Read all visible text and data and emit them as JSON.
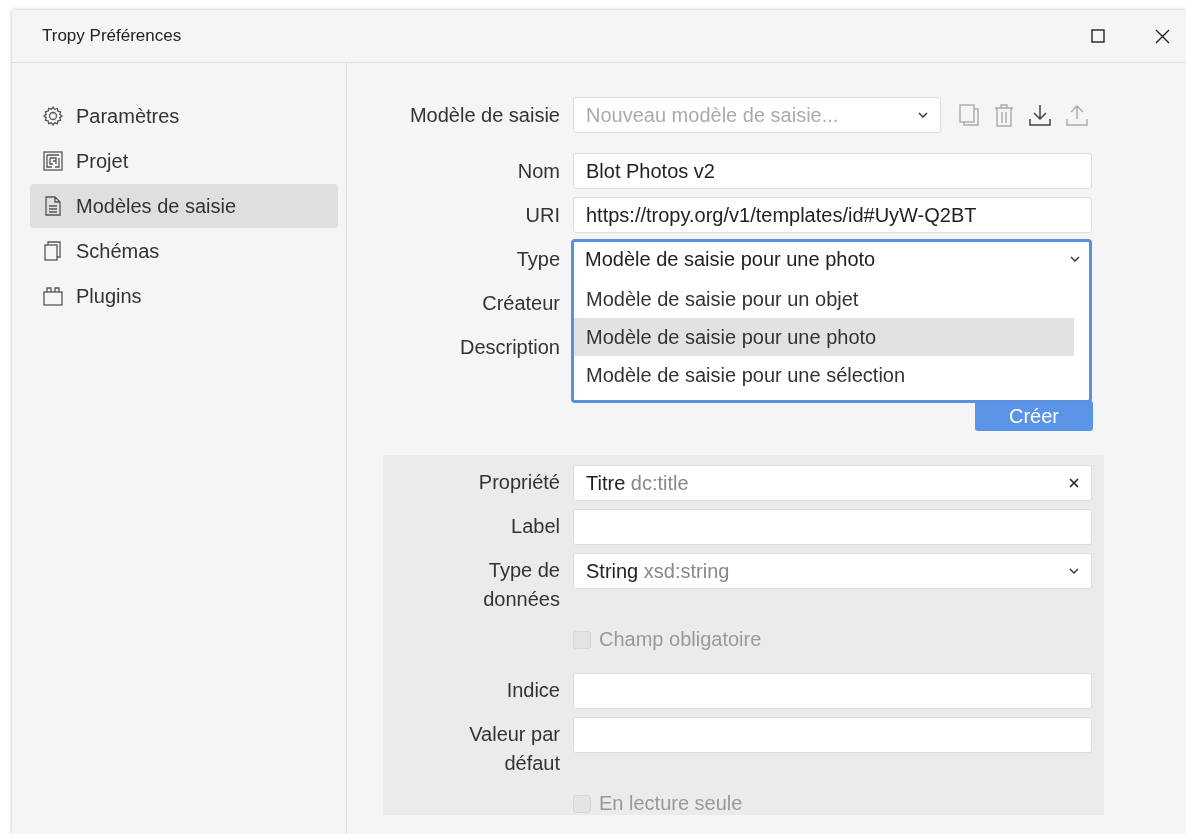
{
  "window": {
    "title": "Tropy Préférences"
  },
  "sidebar": {
    "items": [
      {
        "label": "Paramètres",
        "kind": "settings",
        "selected": false
      },
      {
        "label": "Projet",
        "kind": "project",
        "selected": false
      },
      {
        "label": "Modèles de saisie",
        "kind": "templates",
        "selected": true
      },
      {
        "label": "Schémas",
        "kind": "schemas",
        "selected": false
      },
      {
        "label": "Plugins",
        "kind": "plugins",
        "selected": false
      }
    ]
  },
  "template_form": {
    "template": {
      "label": "Modèle de saisie",
      "placeholder": "Nouveau modèle de saisie..."
    },
    "name": {
      "label": "Nom",
      "value": "Blot Photos v2"
    },
    "uri": {
      "label": "URI",
      "value": "https://tropy.org/v1/templates/id#UyW-Q2BT"
    },
    "type": {
      "label": "Type",
      "value": "Modèle de saisie pour une photo",
      "expanded": true,
      "options": [
        {
          "label": "Modèle de saisie pour un objet",
          "selected": false
        },
        {
          "label": "Modèle de saisie pour une photo",
          "selected": true
        },
        {
          "label": "Modèle de saisie pour une sélection",
          "selected": false
        }
      ]
    },
    "creator": {
      "label": "Créateur"
    },
    "description": {
      "label": "Description"
    },
    "create_button": "Créer"
  },
  "property_form": {
    "rows": [
      {
        "kind": "field",
        "label": "Propriété",
        "value": "Titre",
        "hint": "dc:title",
        "clearable": true
      },
      {
        "kind": "field",
        "label": "Label"
      },
      {
        "kind": "select",
        "label": "Type de données",
        "value": "String",
        "hint": "xsd:string"
      },
      {
        "kind": "checkbox",
        "label": "Champ obligatoire",
        "checked": false,
        "disabled": true
      },
      {
        "kind": "field",
        "label": "Indice"
      },
      {
        "kind": "field",
        "label": "Valeur par défaut"
      },
      {
        "kind": "checkbox",
        "label": "En lecture seule",
        "checked": false,
        "disabled": true
      }
    ]
  }
}
